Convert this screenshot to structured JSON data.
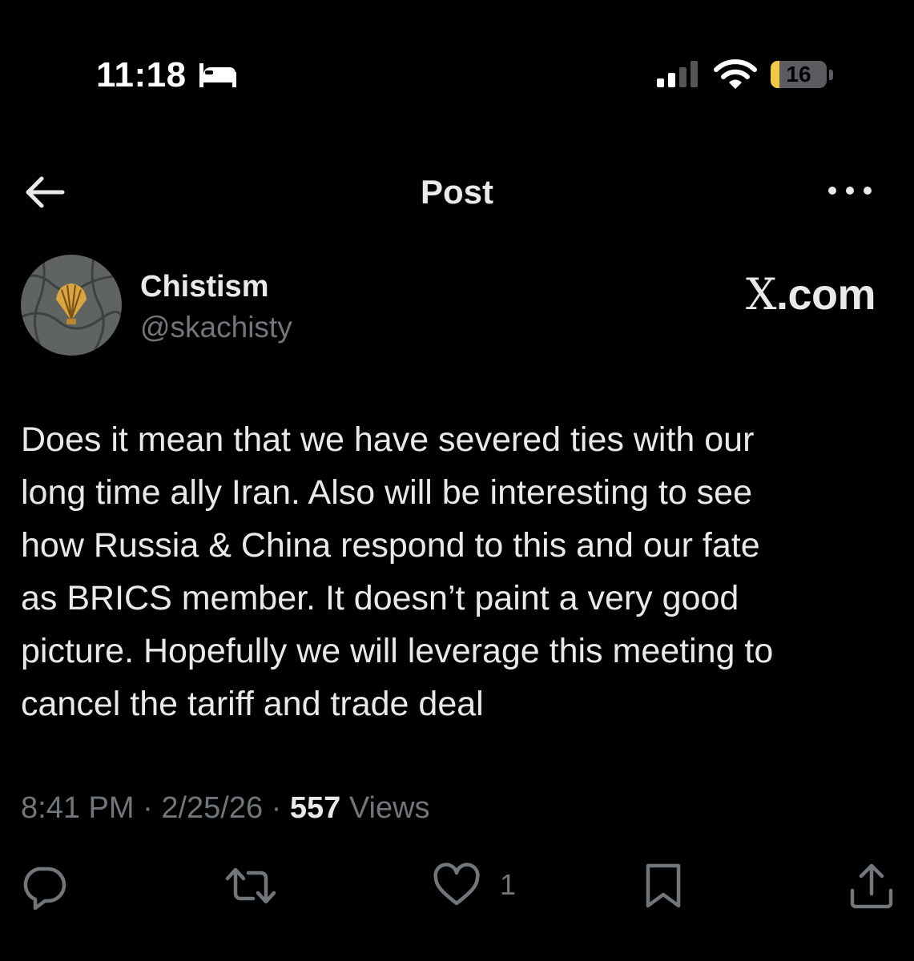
{
  "status_bar": {
    "time": "11:18",
    "sleep_icon": "bed-icon",
    "signal_icon": "cellular-signal-icon",
    "wifi_icon": "wifi-icon",
    "battery_level": "16",
    "battery_fraction": 0.16,
    "battery_color": "#f2c744"
  },
  "header": {
    "back_icon": "arrow-left-icon",
    "title": "Post",
    "more_icon": "more-horizontal-icon"
  },
  "post": {
    "author_name": "Chistism",
    "author_handle": "@skachisty",
    "avatar": "scallop-shell-avatar",
    "watermark": "X.com",
    "text": "Does it mean that we have severed ties with our\nlong time ally Iran. Also will be interesting to see\nhow Russia & China respond to this and our fate\nas BRICS member. It doesn’t paint a very good\npicture. Hopefully we will leverage this meeting to\ncancel the tariff and trade deal",
    "time": "8:41 PM",
    "separator": "·",
    "date": "2/25/26",
    "views_count": "557",
    "views_label": "Views"
  },
  "actions": {
    "reply_icon": "reply-icon",
    "repost_icon": "repost-icon",
    "like_icon": "heart-icon",
    "like_count": "1",
    "bookmark_icon": "bookmark-icon",
    "share_icon": "share-icon"
  },
  "colors": {
    "background": "#000000",
    "primary_text": "#e7e9ea",
    "secondary_text": "#71767b"
  }
}
